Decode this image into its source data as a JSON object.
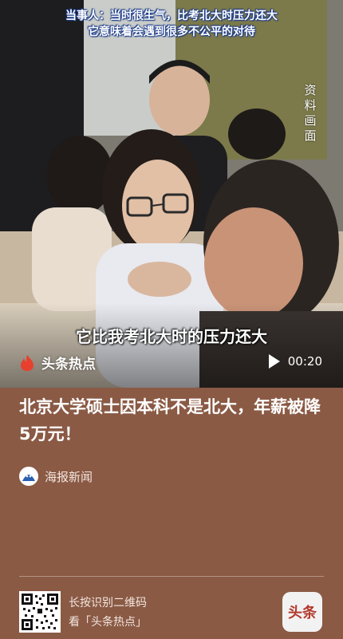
{
  "video": {
    "top_caption_line1": "当事人：当时很生气，比考北大时压力还大",
    "top_caption_line2": "它意味着会遇到很多不公平的对待",
    "side_label": "资料画面",
    "subtitle": "它比我考北大时的压力还大",
    "brand_label": "头条热点",
    "duration": "00:20",
    "brand_color": "#e8402f"
  },
  "article": {
    "headline": "北京大学硕士因本科不是北大，年薪被降5万元！",
    "source_name": "海报新闻"
  },
  "footer": {
    "qr_line1": "长按识别二维码",
    "qr_line2": "看「头条热点」",
    "app_icon_label": "头条"
  },
  "colors": {
    "background": "#8a5a45",
    "caption_outline": "#1a3a8a"
  }
}
